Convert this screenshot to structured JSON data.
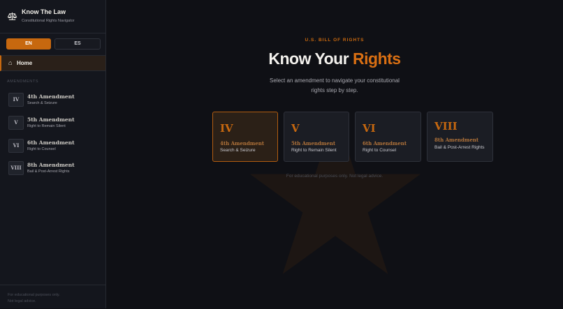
{
  "brand": {
    "title": "Know The Law",
    "subtitle": "Constitutional Rights Navigator",
    "icon": "scales-icon"
  },
  "language": {
    "options": [
      "EN",
      "ES"
    ],
    "selected": "EN"
  },
  "nav": {
    "home_label": "Home",
    "section_label": "AMENDMENTS",
    "amendments": [
      {
        "numeral": "IV",
        "title": "4th Amendment",
        "subtitle": "Search & Seizure"
      },
      {
        "numeral": "V",
        "title": "5th Amendment",
        "subtitle": "Right to Remain Silent"
      },
      {
        "numeral": "VI",
        "title": "6th Amendment",
        "subtitle": "Right to Counsel"
      },
      {
        "numeral": "VIII",
        "title": "8th Amendment",
        "subtitle": "Bail & Post-Arrest Rights"
      }
    ],
    "footer_lines": [
      "For educational purposes only.",
      "Not legal advice."
    ]
  },
  "hero": {
    "eyebrow": "U.S. BILL OF RIGHTS",
    "headline_prefix": "Know Your",
    "headline_accent": "Rights",
    "lead": "Select an amendment to navigate your constitutional rights step by step.",
    "cards": [
      {
        "numeral": "IV",
        "title": "4th Amendment",
        "subtitle": "Search & Seizure"
      },
      {
        "numeral": "V",
        "title": "5th Amendment",
        "subtitle": "Right to Remain Silent"
      },
      {
        "numeral": "VI",
        "title": "6th Amendment",
        "subtitle": "Right to Counsel"
      },
      {
        "numeral": "VIII",
        "title": "8th Amendment",
        "subtitle": "Bail & Post-Arrest Rights"
      }
    ],
    "disclaimer": "For educational purposes only. Not legal advice."
  },
  "colors": {
    "accent": "#c7680f",
    "background": "#0f1015",
    "sidebar": "#14161d"
  }
}
